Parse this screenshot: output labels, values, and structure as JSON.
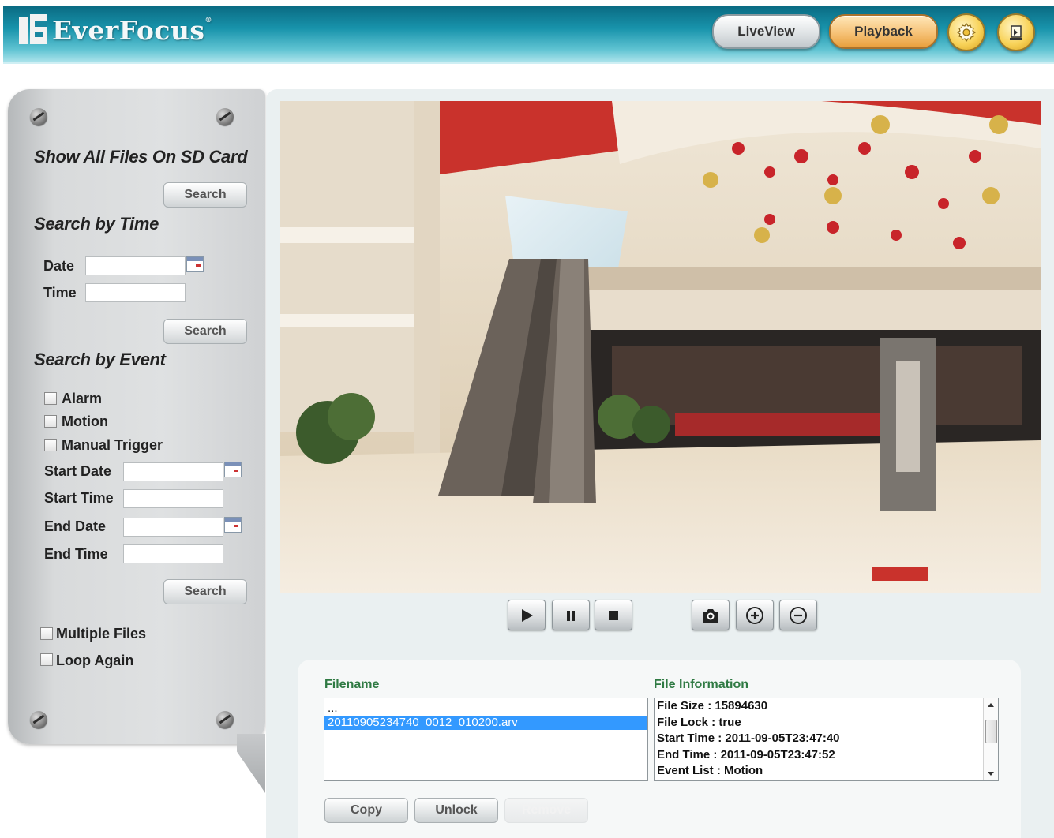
{
  "header": {
    "brand": "EverFocus",
    "brand_mark": "®",
    "liveview_label": "LiveView",
    "playback_label": "Playback",
    "settings_icon": "gear-icon",
    "logout_icon": "exit-icon"
  },
  "sidebar": {
    "all_files_title": "Show All Files On SD Card",
    "search_label": "Search",
    "time_title": "Search by Time",
    "date_label": "Date",
    "time_label": "Time",
    "date_value": "",
    "time_value": "",
    "event_title": "Search by Event",
    "events": [
      {
        "label": "Alarm",
        "checked": false
      },
      {
        "label": "Motion",
        "checked": false
      },
      {
        "label": "Manual Trigger",
        "checked": false
      }
    ],
    "start_date_label": "Start Date",
    "start_time_label": "Start Time",
    "end_date_label": "End Date",
    "end_time_label": "End Time",
    "multiple_files_label": "Multiple Files",
    "loop_again_label": "Loop Again",
    "multiple_files_checked": false,
    "loop_again_checked": false
  },
  "player": {
    "controls": [
      "play-icon",
      "pause-icon",
      "stop-icon",
      "camera-icon",
      "zoom-in-icon",
      "zoom-out-icon"
    ]
  },
  "files": {
    "filename_header": "Filename",
    "info_header": "File Information",
    "list": [
      "...",
      "20110905234740_0012_010200.arv"
    ],
    "selected_index": 1,
    "info": [
      "File Size : 15894630",
      "File Lock : true",
      "Start Time : 2011-09-05T23:47:40",
      "End Time : 2011-09-05T23:47:52",
      "Event List : Motion"
    ],
    "copy_label": "Copy",
    "unlock_label": "Unlock",
    "remove_label": "Remove"
  },
  "colors": {
    "header_teal": "#1893ab",
    "playback_orange": "#f6c277",
    "selection_blue": "#3399ff",
    "column_title_green": "#2f7a43"
  }
}
